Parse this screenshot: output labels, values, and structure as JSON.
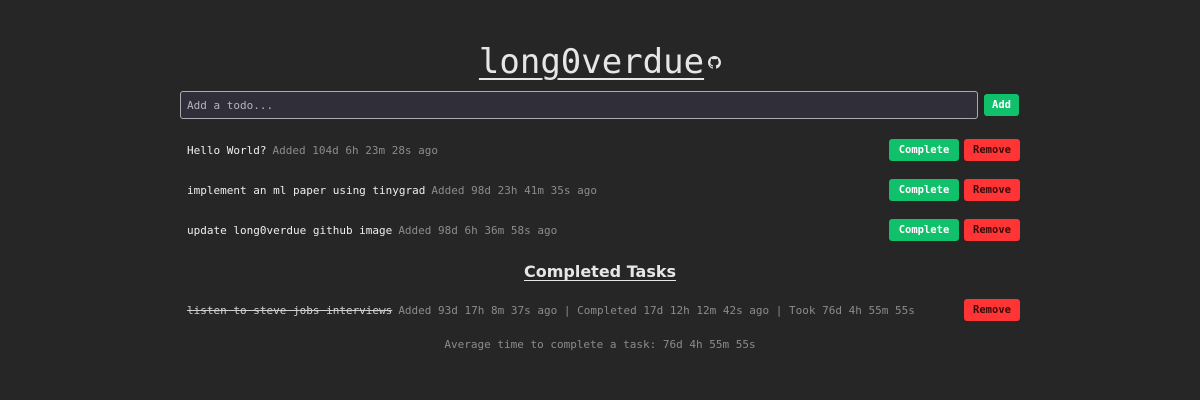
{
  "header": {
    "title": "long0verdue",
    "github_icon": "github-icon"
  },
  "input": {
    "placeholder": "Add a todo...",
    "value": "",
    "add_label": "Add"
  },
  "tasks": [
    {
      "name": "Hello World?",
      "meta": "Added 104d 6h 23m 28s ago",
      "complete_label": "Complete",
      "remove_label": "Remove"
    },
    {
      "name": "implement an ml paper using tinygrad",
      "meta": "Added 98d 23h 41m 35s ago",
      "complete_label": "Complete",
      "remove_label": "Remove"
    },
    {
      "name": "update long0verdue github image",
      "meta": "Added 98d 6h 36m 58s ago",
      "complete_label": "Complete",
      "remove_label": "Remove"
    }
  ],
  "completed": {
    "heading": "Completed Tasks",
    "items": [
      {
        "name": "listen to steve jobs interviews",
        "meta": "Added 93d 17h 8m 37s ago | Completed 17d 12h 12m 42s ago | Took 76d 4h 55m 55s",
        "remove_label": "Remove"
      }
    ],
    "average": "Average time to complete a task: 76d 4h 55m 55s"
  },
  "colors": {
    "background": "#262626",
    "complete_button": "#10c06a",
    "remove_button": "#ff3434"
  }
}
